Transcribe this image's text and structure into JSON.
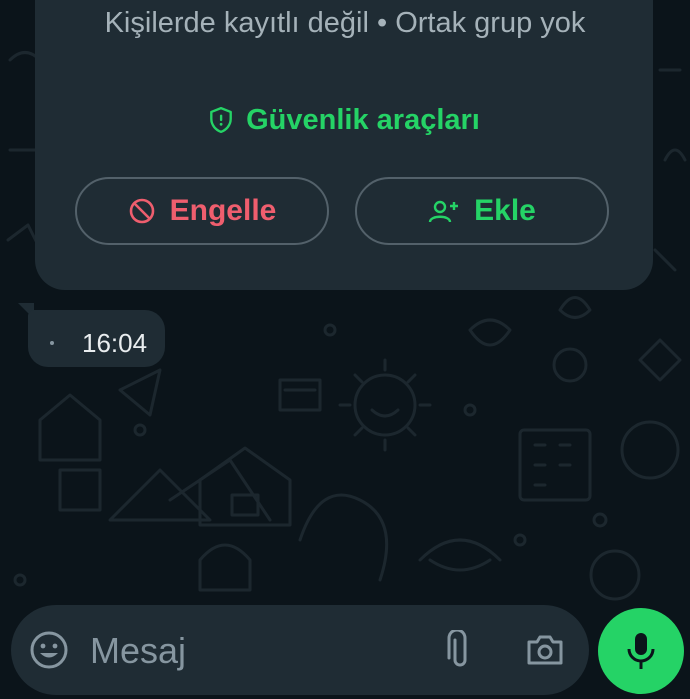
{
  "colors": {
    "background": "#0b141a",
    "card": "#1f2c34",
    "accent_green": "#25d366",
    "danger_red": "#ef5e6e",
    "secondary_text": "#a5b2b9"
  },
  "contact_card": {
    "info_line": "Kişilerde kayıtlı değil • Ortak grup yok",
    "safety_tools_label": "Güvenlik araçları",
    "safety_icon": "shield-icon",
    "block_label": "Engelle",
    "block_icon": "block-icon",
    "add_label": "Ekle",
    "add_icon": "add-contact-icon"
  },
  "message": {
    "time": "16:04"
  },
  "composer": {
    "placeholder": "Mesaj",
    "emoji_icon": "emoji-icon",
    "attach_icon": "paperclip-icon",
    "camera_icon": "camera-icon",
    "mic_icon": "microphone-icon"
  }
}
